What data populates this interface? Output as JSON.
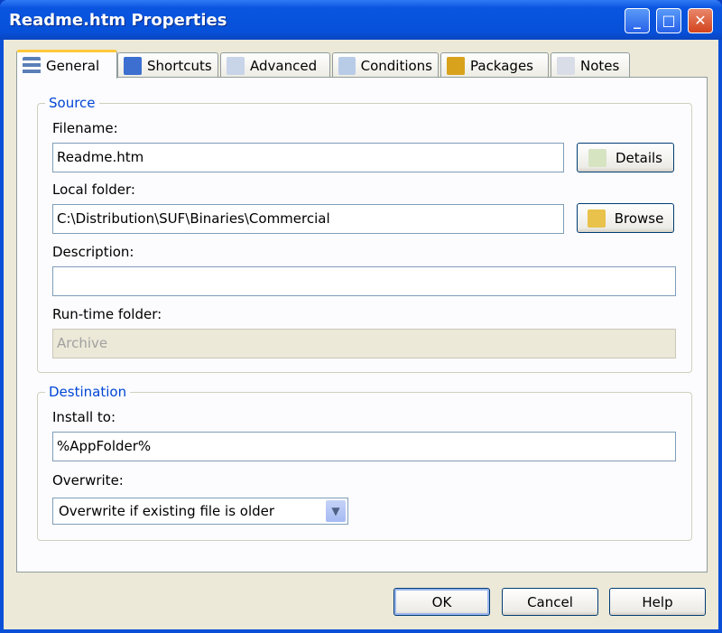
{
  "window": {
    "title": "Readme.htm Properties"
  },
  "tabs": [
    {
      "label": "General",
      "icon": "general-icon",
      "active": true
    },
    {
      "label": "Shortcuts",
      "icon": "shortcuts-icon"
    },
    {
      "label": "Advanced",
      "icon": "advanced-icon"
    },
    {
      "label": "Conditions",
      "icon": "conditions-icon"
    },
    {
      "label": "Packages",
      "icon": "packages-icon"
    },
    {
      "label": "Notes",
      "icon": "notes-icon"
    }
  ],
  "source": {
    "legend": "Source",
    "filename_label": "Filename:",
    "filename": "Readme.htm",
    "details_label": "Details",
    "local_folder_label": "Local folder:",
    "local_folder": "C:\\Distribution\\SUF\\Binaries\\Commercial",
    "browse_label": "Browse",
    "description_label": "Description:",
    "description": "",
    "runtime_label": "Run-time folder:",
    "runtime": "Archive"
  },
  "destination": {
    "legend": "Destination",
    "install_label": "Install to:",
    "install": "%AppFolder%",
    "overwrite_label": "Overwrite:",
    "overwrite": "Overwrite if existing file is older"
  },
  "buttons": {
    "ok": "OK",
    "cancel": "Cancel",
    "help": "Help"
  }
}
